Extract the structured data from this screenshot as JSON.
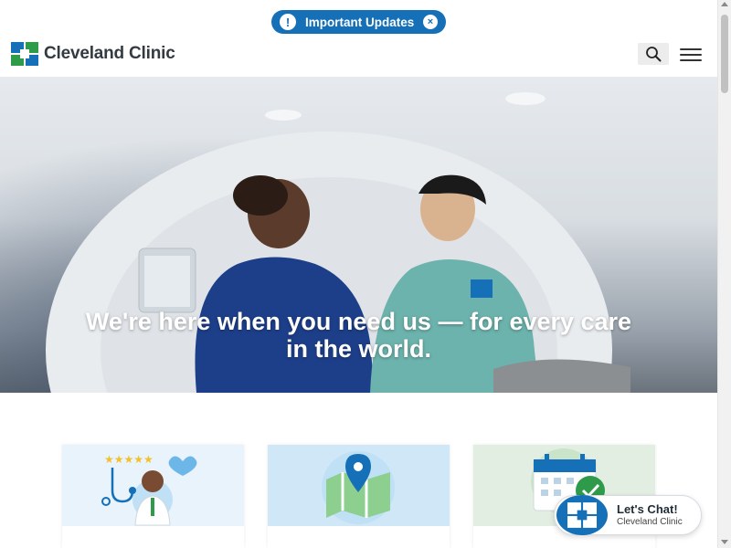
{
  "banner": {
    "label": "Important Updates",
    "alert_icon": "!",
    "close_icon": "×"
  },
  "header": {
    "brand": "Cleveland Clinic"
  },
  "hero": {
    "line1": "We're here when you need us — for every care",
    "line2": "in the world."
  },
  "cards": [
    {
      "icon": "doctor-rating-icon"
    },
    {
      "icon": "map-pin-icon"
    },
    {
      "icon": "calendar-check-icon"
    }
  ],
  "chat": {
    "title": "Let's Chat!",
    "subtitle": "Cleveland Clinic"
  },
  "colors": {
    "brand_blue": "#1570b8",
    "brand_green": "#2e9b4a",
    "text_dark": "#333a40"
  }
}
